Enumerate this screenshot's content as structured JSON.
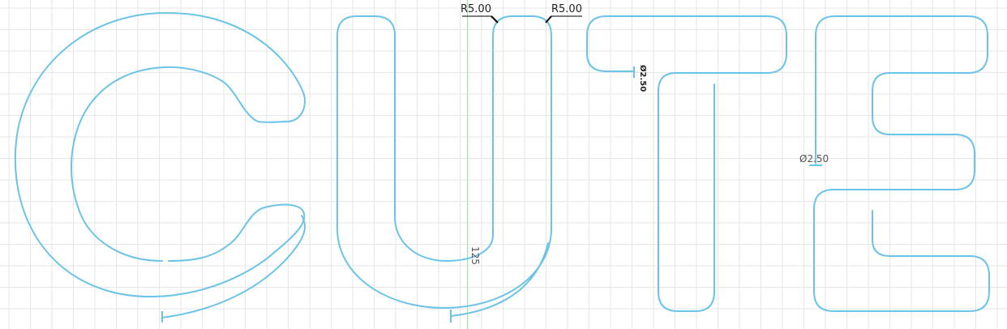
{
  "colors": {
    "background": "#ffffff",
    "grid": "#e6e6e6",
    "profile": "#6cc3e8",
    "axis": "#90ee90",
    "dimension": "#000000"
  },
  "dimensions": {
    "radius_left": "R5.00",
    "radius_right": "R5.00",
    "diameter_t": "Ø2.50",
    "diameter_e": "Ø2.50",
    "length_u": "125"
  }
}
